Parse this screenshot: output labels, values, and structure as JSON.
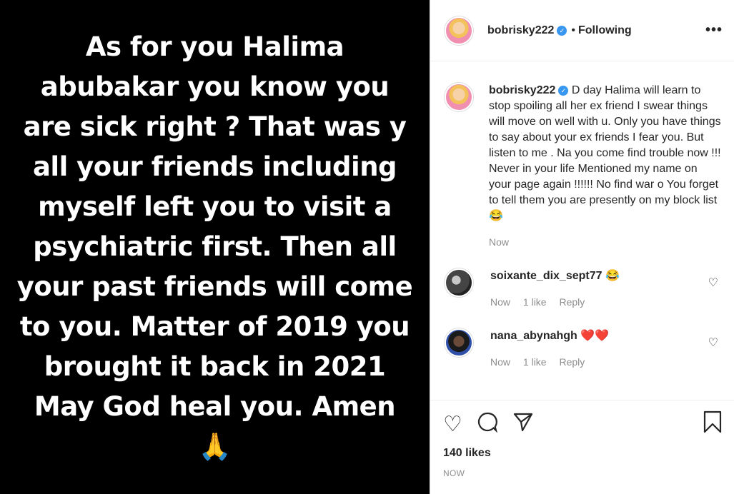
{
  "media": {
    "text": "As for you Halima abubakar you know you are sick right ? That was y all your friends including myself left you to visit a psychiatric first. Then all your past friends will come to you. Matter of 2019 you brought it back in 2021 May God heal you. Amen",
    "emoji": "🙏"
  },
  "header": {
    "username": "bobrisky222",
    "separator": "•",
    "follow_status": "Following",
    "more": "•••"
  },
  "caption": {
    "username": "bobrisky222",
    "text": "D day Halima will learn to stop spoiling all her ex friend I swear things will move on well with u. Only you have things to say about your ex friends I fear you. But listen to me . Na you come find trouble now !!! Never in your life Mentioned my name on your page again !!!!!! No find war o You forget to tell them you are presently on my block list",
    "emoji": "😂",
    "time": "Now"
  },
  "comments": [
    {
      "username": "soixante_dix_sept77",
      "text": "😂",
      "time": "Now",
      "likes": "1 like",
      "reply": "Reply"
    },
    {
      "username": "nana_abynahgh",
      "text": "❤️❤️",
      "time": "Now",
      "likes": "1 like",
      "reply": "Reply"
    }
  ],
  "actions": {
    "likes": "140 likes",
    "timestamp": "NOW"
  },
  "colors": {
    "media_bg": "#000000",
    "verified": "#3897f0",
    "muted": "#8e8e8e"
  }
}
